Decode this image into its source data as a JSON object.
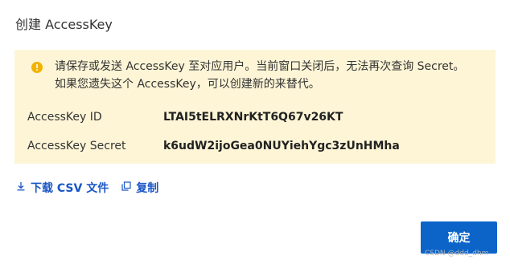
{
  "dialog": {
    "title": "创建 AccessKey"
  },
  "warning": {
    "icon": "warning-circle-icon",
    "color": "#f2b200",
    "text": "请保存或发送 AccessKey 至对应用户。当前窗口关闭后，无法再次查询 Secret。如果您遗失这个 AccessKey，可以创建新的来替代。"
  },
  "fields": [
    {
      "label": "AccessKey ID",
      "value": "LTAI5tELRXNrKtT6Q67v26KT"
    },
    {
      "label": "AccessKey Secret",
      "value": "k6udW2ijoGea0NUYiehYgc3zUnHMha"
    }
  ],
  "actions": {
    "download_label": "下载 CSV 文件",
    "download_icon": "download-icon",
    "copy_label": "复制",
    "copy_icon": "copy-icon"
  },
  "confirm_label": "确定",
  "watermark": "CSDN @ddd_dhm",
  "colors": {
    "panel_bg": "#fdf5d6",
    "accent": "#0c64c8",
    "link": "#1a56c6"
  }
}
